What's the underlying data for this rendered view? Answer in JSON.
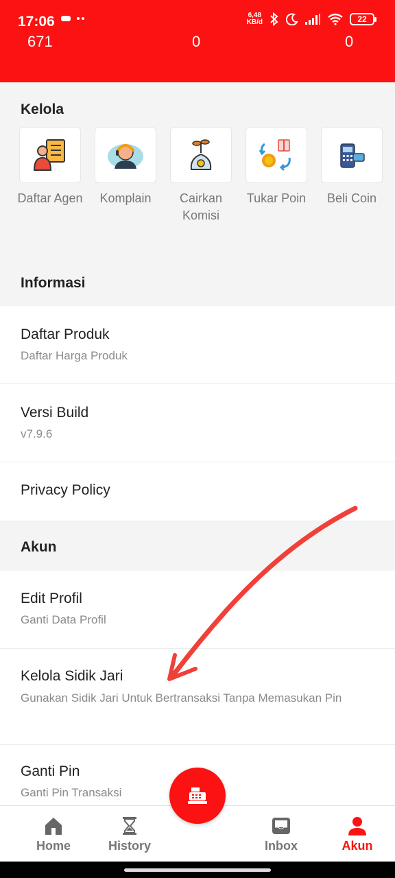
{
  "status_bar": {
    "time": "17:06",
    "extra_icons": " ••",
    "net_speed_value": "6,48",
    "net_speed_unit": "KB/d",
    "battery": "22"
  },
  "header": {
    "counters": [
      "671",
      "0",
      "0"
    ]
  },
  "kelola": {
    "title": "Kelola",
    "tiles": [
      {
        "label": "Daftar Agen",
        "icon": "agent-register-icon"
      },
      {
        "label": "Komplain",
        "icon": "support-agent-icon"
      },
      {
        "label": "Cairkan Komisi",
        "icon": "money-bag-plant-icon"
      },
      {
        "label": "Tukar Poin",
        "icon": "exchange-points-icon"
      },
      {
        "label": "Beli Coin",
        "icon": "payment-terminal-icon"
      }
    ]
  },
  "informasi": {
    "title": "Informasi",
    "items": [
      {
        "title": "Daftar Produk",
        "subtitle": "Daftar Harga Produk"
      },
      {
        "title": "Versi Build",
        "subtitle": "v7.9.6"
      },
      {
        "title": "Privacy Policy",
        "subtitle": ""
      }
    ]
  },
  "akun": {
    "title": "Akun",
    "items": [
      {
        "title": "Edit Profil",
        "subtitle": "Ganti Data Profil"
      },
      {
        "title": "Kelola Sidik Jari",
        "subtitle": "Gunakan Sidik Jari Untuk Bertransaksi Tanpa Memasukan Pin"
      },
      {
        "title": "Ganti Pin",
        "subtitle": "Ganti Pin Transaksi"
      }
    ]
  },
  "bottom_nav": {
    "items": [
      {
        "label": "Home",
        "icon": "home-icon"
      },
      {
        "label": "History",
        "icon": "hourglass-icon"
      },
      {
        "label": "Inbox",
        "icon": "inbox-icon"
      },
      {
        "label": "Akun",
        "icon": "user-icon",
        "active": true
      }
    ],
    "fab_icon": "cash-register-icon"
  },
  "colors": {
    "brand": "#fc1212",
    "annotation_arrow": "#f0403a"
  }
}
